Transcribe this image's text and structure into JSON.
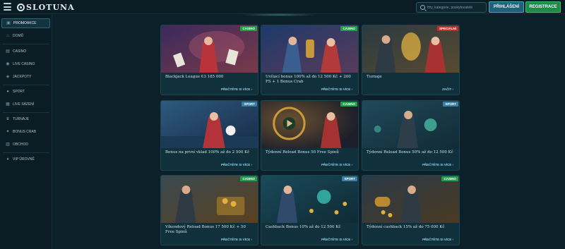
{
  "header": {
    "logo_text": "SLOTUNA",
    "search_placeholder": "Hry, kategorie, poskytovatelé",
    "login_label": "PŘIHLÁŠENÍ",
    "register_label": "REGISTRACE"
  },
  "sidebar": {
    "items": [
      {
        "label": "PROMOAKCE",
        "icon": "gift-icon"
      },
      {
        "label": "DOMŮ",
        "icon": "home-icon"
      },
      {
        "label": "CASINO",
        "icon": "slot-icon"
      },
      {
        "label": "LIVE CASINO",
        "icon": "live-icon"
      },
      {
        "label": "JACKPOTY",
        "icon": "jackpot-icon"
      },
      {
        "label": "SPORT",
        "icon": "ball-icon"
      },
      {
        "label": "LIVE SÁZENÍ",
        "icon": "live-bet-icon"
      },
      {
        "label": "TURNAJE",
        "icon": "trophy-icon"
      },
      {
        "label": "BONUS CRAB",
        "icon": "crab-icon"
      },
      {
        "label": "OBCHOD",
        "icon": "shop-icon"
      },
      {
        "label": "VIP ÚROVNĚ",
        "icon": "vip-icon"
      }
    ]
  },
  "cards": [
    {
      "tag": "CASINO",
      "tag_type": "casino",
      "title": "Blackjack League €3 185 000",
      "link": "PŘEČTĚTE SI VÍCE ›"
    },
    {
      "tag": "CASINO",
      "tag_type": "casino",
      "title": "Uvítací bonus 100% až do 12 500 Kč + 200 FS + 1 Bonus Crab",
      "link": "PŘEČTĚTE SI VÍCE ›"
    },
    {
      "tag": "SPECIÁLNÍ",
      "tag_type": "special",
      "title": "Turnaje",
      "link": "ZAČÍT ›"
    },
    {
      "tag": "SPORT",
      "tag_type": "sport",
      "title": "Bonus na první vklad 100% až do 2 500 Kč",
      "link": "PŘEČTĚTE SI VÍCE ›"
    },
    {
      "tag": "CASINO",
      "tag_type": "casino",
      "title": "Týdenní Reload Bonus 50 Free Spinů",
      "link": "PŘEČTĚTE SI VÍCE ›"
    },
    {
      "tag": "SPORT",
      "tag_type": "sport",
      "title": "Týdenní Reload Bonus 50% až do 12 500 Kč",
      "link": "PŘEČTĚTE SI VÍCE ›"
    },
    {
      "tag": "CASINO",
      "tag_type": "casino",
      "title": "Víkendový Reload Bonus 17 500 Kč + 50 Free Spinů",
      "link": "PŘEČTĚTE SI VÍCE ›"
    },
    {
      "tag": "SPORT",
      "tag_type": "sport",
      "title": "Cashback Bonus 10% až do 12 500 Kč",
      "link": "PŘEČTĚTE SI VÍCE ›"
    },
    {
      "tag": "CASINO",
      "tag_type": "casino",
      "title": "Týdenní cashback 15% až do 75 000 Kč",
      "link": "PŘEČTĚTE SI VÍCE ›"
    }
  ],
  "colors": {
    "background": "#0b2029",
    "accent": "#8ed3ea",
    "casino_tag": "#21a04b",
    "sport_tag": "#3e7fa3",
    "special_tag": "#b8322b",
    "register": "#1c8a48"
  }
}
